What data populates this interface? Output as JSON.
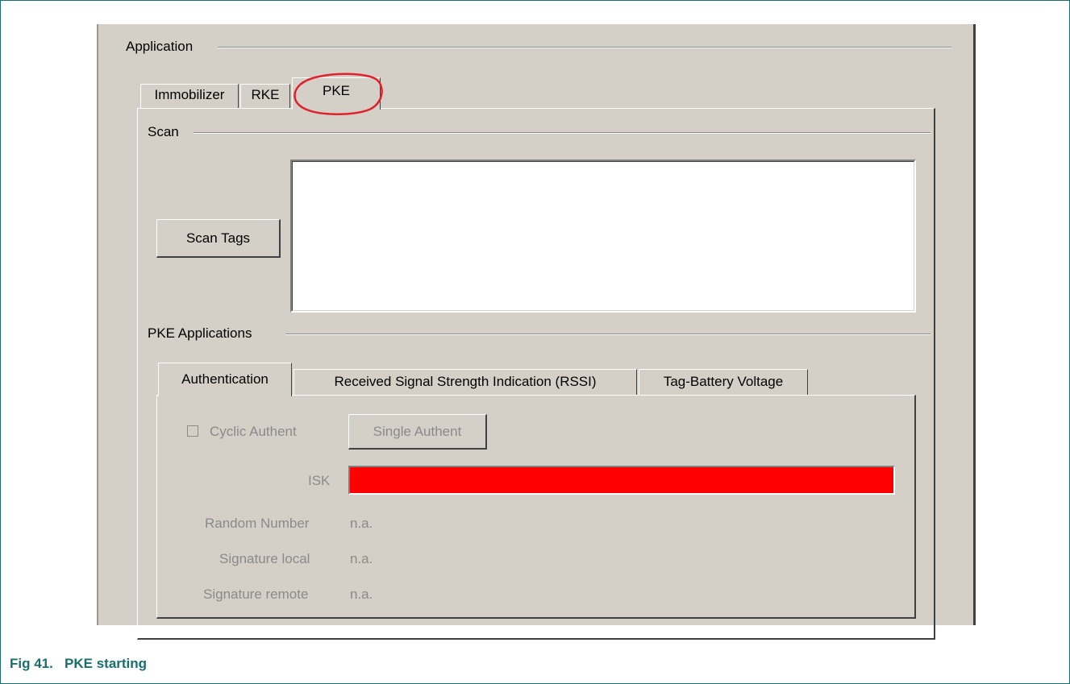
{
  "application": {
    "group_label": "Application",
    "tabs": [
      {
        "label": "Immobilizer"
      },
      {
        "label": "RKE"
      },
      {
        "label": "PKE"
      }
    ],
    "active_tab": "PKE"
  },
  "scan": {
    "group_label": "Scan",
    "button_label": "Scan Tags"
  },
  "pke_applications": {
    "group_label": "PKE Applications",
    "tabs": [
      {
        "label": "Authentication"
      },
      {
        "label": "Received Signal Strength Indication (RSSI)"
      },
      {
        "label": "Tag-Battery Voltage"
      }
    ],
    "active_tab": "Authentication"
  },
  "authentication": {
    "cyclic_label": "Cyclic Authent",
    "cyclic_checked": false,
    "single_button_label": "Single Authent",
    "isk_label": "ISK",
    "isk_color": "#ff0000",
    "random_number_label": "Random Number",
    "random_number_value": "n.a.",
    "signature_local_label": "Signature local",
    "signature_local_value": "n.a.",
    "signature_remote_label": "Signature remote",
    "signature_remote_value": "n.a."
  },
  "highlight_color": "#e0202a",
  "caption": {
    "figure": "Fig 41.",
    "title": "PKE starting"
  }
}
